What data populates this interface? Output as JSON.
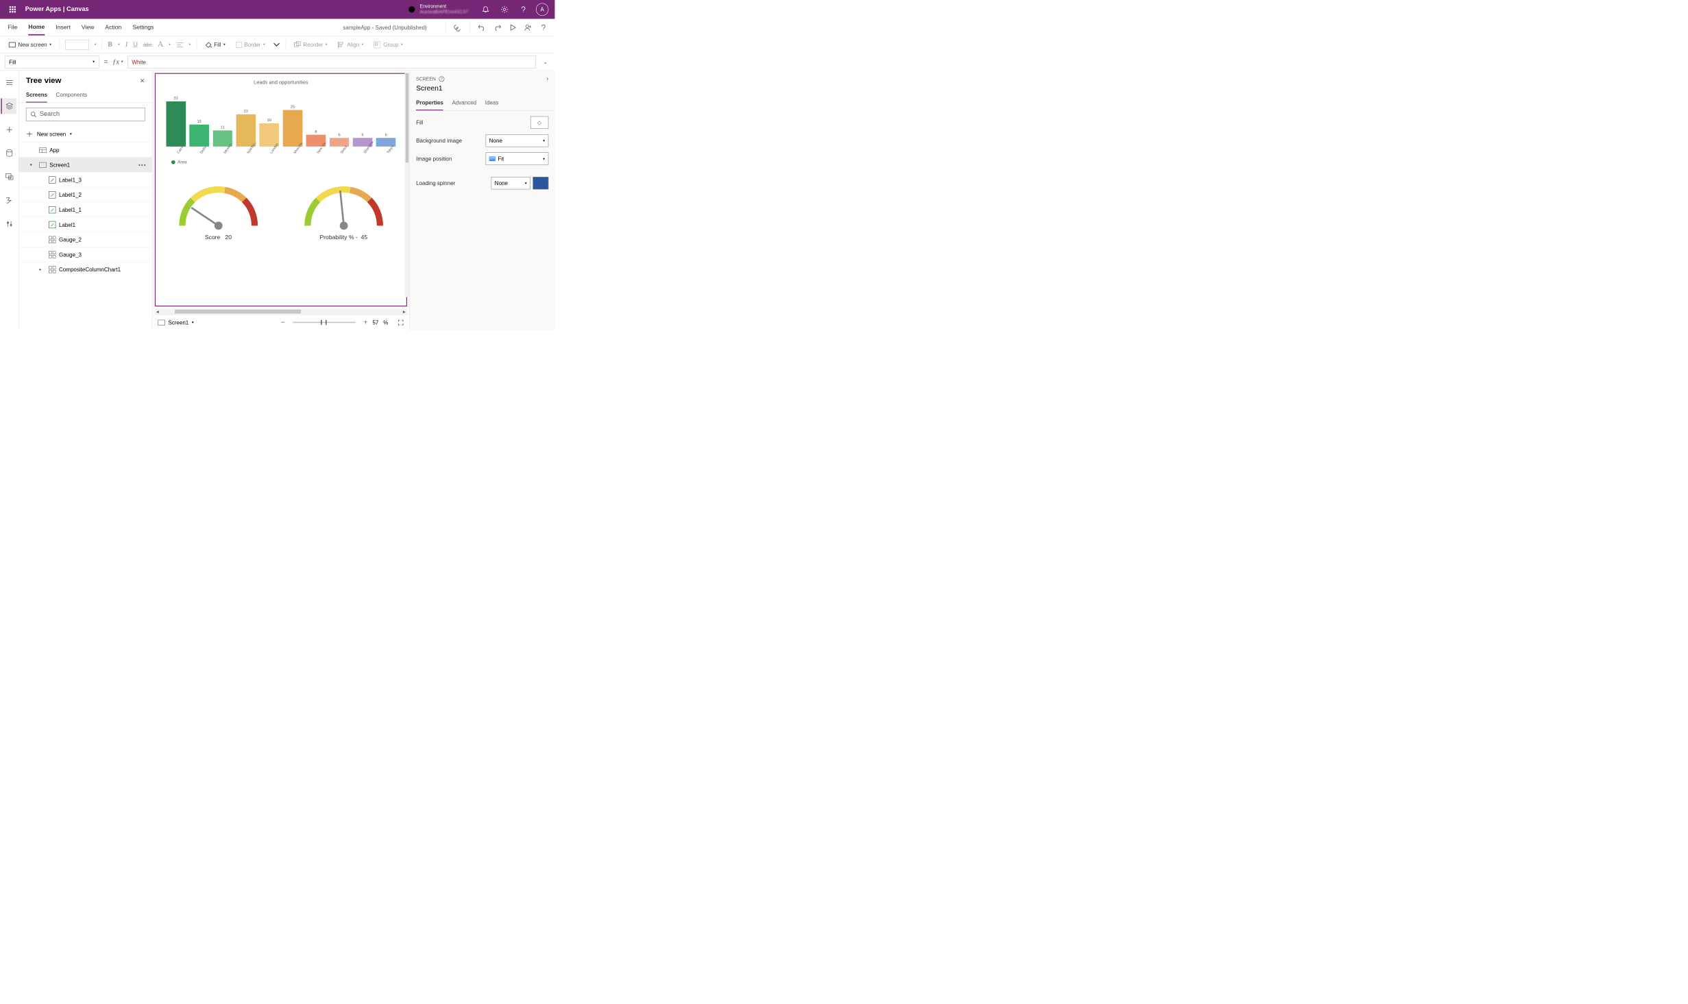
{
  "titlebar": {
    "app_name": "Power Apps  |  Canvas",
    "env_label": "Environment",
    "env_value": "AuroraBAPEnv43137",
    "avatar_initial": "A"
  },
  "menubar": {
    "tabs": [
      "File",
      "Home",
      "Insert",
      "View",
      "Action",
      "Settings"
    ],
    "active_index": 1,
    "doc_status": "sampleApp - Saved (Unpublished)"
  },
  "ribbon": {
    "new_screen": "New screen",
    "fill": "Fill",
    "border": "Border",
    "reorder": "Reorder",
    "align": "Align",
    "group": "Group"
  },
  "formula": {
    "property": "Fill",
    "value": "White"
  },
  "tree": {
    "title": "Tree view",
    "tabs": [
      "Screens",
      "Components"
    ],
    "active_tab": 0,
    "search_placeholder": "Search",
    "new_screen": "New screen",
    "nodes": {
      "app": "App",
      "screen1": "Screen1",
      "label13": "Label1_3",
      "label12": "Label1_2",
      "label11": "Label1_1",
      "label1": "Label1",
      "gauge2": "Gauge_2",
      "gauge3": "Gauge_3",
      "chart1": "CompositeColumnChart1"
    }
  },
  "canvas": {
    "chart_title": "Leads and opportunities",
    "legend_series": "Area",
    "gauge1_label": "Score",
    "gauge1_value": "20",
    "gauge2_label": "Probability % -",
    "gauge2_value": "45",
    "status_screen": "Screen1",
    "zoom_pct": "57",
    "zoom_unit": "%"
  },
  "chart_data": {
    "type": "bar",
    "title": "Leads and opportunities",
    "categories": [
      "Cairo",
      "Delhi",
      "Mexico ...",
      "Istanbu...",
      "London",
      "Moscow",
      "New Yor...",
      "Seoul",
      "Shangha...",
      "Tokyo"
    ],
    "values": [
      31,
      15,
      11,
      22,
      16,
      25,
      8,
      6,
      6,
      6
    ],
    "colors": [
      "#2e8b57",
      "#3cb371",
      "#66c285",
      "#e6b85c",
      "#f0c97a",
      "#e8a84d",
      "#ef8e6b",
      "#f2a38a",
      "#b596d1",
      "#7fa7d9"
    ],
    "series_name": "Area",
    "ylim": [
      0,
      35
    ]
  },
  "props": {
    "type_label": "SCREEN",
    "object_name": "Screen1",
    "tabs": [
      "Properties",
      "Advanced",
      "Ideas"
    ],
    "active_tab": 0,
    "rows": {
      "fill": "Fill",
      "bg": "Background image",
      "bg_val": "None",
      "imgpos": "Image position",
      "imgpos_val": "Fit",
      "spinner": "Loading spinner",
      "spinner_val": "None"
    }
  }
}
